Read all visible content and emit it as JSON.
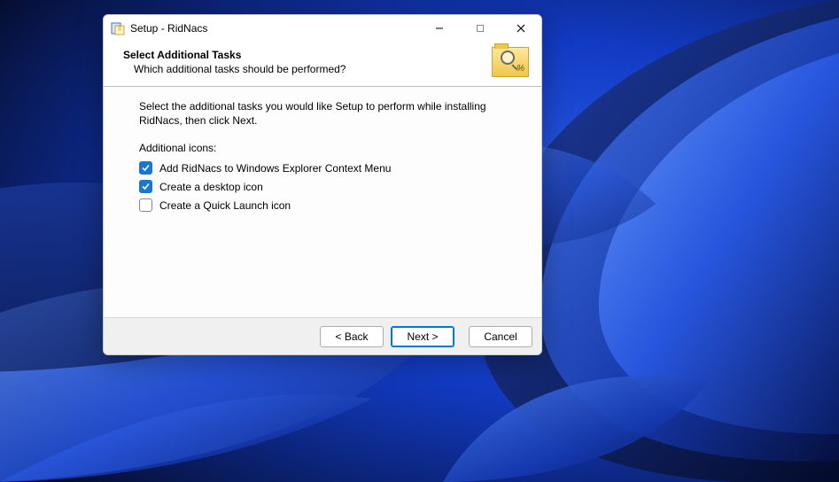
{
  "window": {
    "title": "Setup - RidNacs"
  },
  "header": {
    "title": "Select Additional Tasks",
    "subtitle": "Which additional tasks should be performed?"
  },
  "content": {
    "intro": "Select the additional tasks you would like Setup to perform while installing RidNacs, then click Next.",
    "section_label": "Additional icons:",
    "options": [
      {
        "label": "Add RidNacs to Windows Explorer Context Menu",
        "checked": true
      },
      {
        "label": "Create a desktop icon",
        "checked": true
      },
      {
        "label": "Create a Quick Launch icon",
        "checked": false
      }
    ]
  },
  "footer": {
    "back": "< Back",
    "next": "Next >",
    "cancel": "Cancel"
  }
}
